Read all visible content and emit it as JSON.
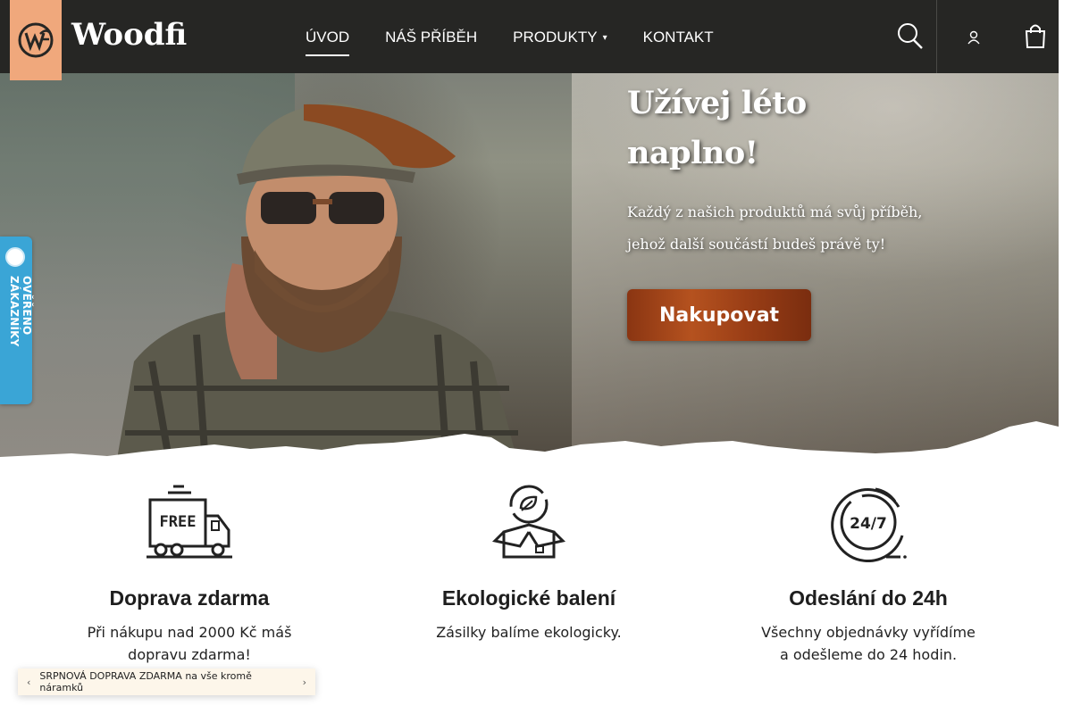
{
  "brand": {
    "logo_text": "Woodfi",
    "accent_color": "#f0a87c",
    "header_bg": "#262624",
    "button_color": "#a0431a"
  },
  "nav": {
    "items": [
      {
        "label": "ÚVOD",
        "active": true
      },
      {
        "label": "NÁŠ PŘÍBĚH"
      },
      {
        "label": "PRODUKTY",
        "has_dropdown": true
      },
      {
        "label": "KONTAKT"
      }
    ],
    "icons": [
      "search-icon",
      "user-icon",
      "cart-icon"
    ]
  },
  "hero": {
    "title_line1": "Užívej léto",
    "title_line2": "naplno!",
    "subtitle_line1": "Každý z našich produktů má svůj příběh,",
    "subtitle_line2": "jehož další součástí budeš právě ty!",
    "cta_label": "Nakupovat"
  },
  "verified_tab": {
    "label": "OVĚŘENO ZÁKAZNÍKY",
    "color": "#3aa5d6"
  },
  "features": [
    {
      "icon": "free-truck-icon",
      "title": "Doprava zdarma",
      "line1": "Při nákupu nad 2000 Kč máš",
      "line2": "dopravu zdarma!"
    },
    {
      "icon": "eco-box-icon",
      "title": "Ekologické balení",
      "line1": "Zásilky balíme ekologicky.",
      "line2": ""
    },
    {
      "icon": "clock-24-7-icon",
      "title": "Odeslání do 24h",
      "line1": "Všechny objednávky vyřídíme",
      "line2": "a odešleme do 24 hodin."
    }
  ],
  "promo_bar": {
    "text": "SRPNOVÁ DOPRAVA ZDARMA na vše kromě náramků"
  }
}
